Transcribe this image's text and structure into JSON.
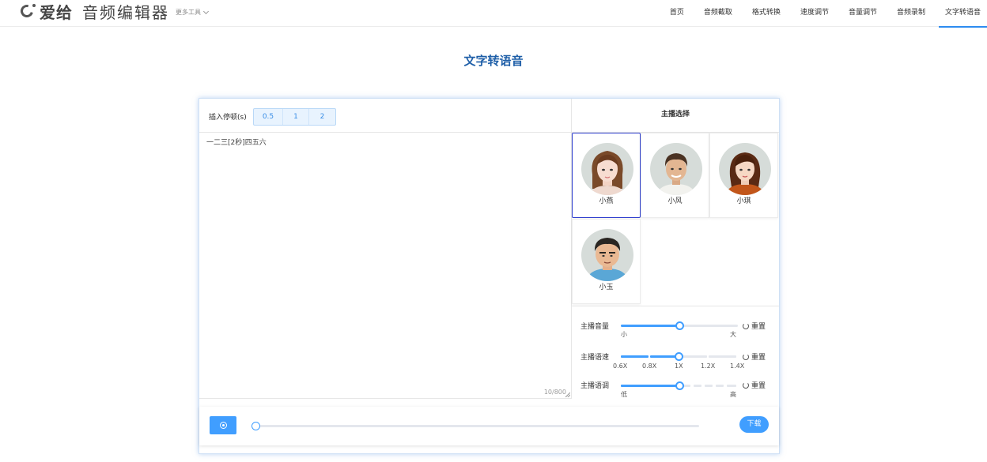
{
  "header": {
    "brand": "爱给",
    "subtitle": "音频编辑器",
    "more_tools": "更多工具",
    "nav": [
      "首页",
      "音频截取",
      "格式转换",
      "速度调节",
      "音量调节",
      "音频录制",
      "文字转语音"
    ],
    "active_nav": "文字转语音"
  },
  "page": {
    "title": "文字转语音"
  },
  "editor": {
    "pause_label": "插入停顿(s)",
    "pause_options": [
      "0.5",
      "1",
      "2"
    ],
    "text": "一二三[2秒]四五六",
    "char_count": "10/800"
  },
  "anchors": {
    "heading": "主播选择",
    "voices": [
      {
        "name": "小燕",
        "selected": true
      },
      {
        "name": "小风",
        "selected": false
      },
      {
        "name": "小琪",
        "selected": false
      },
      {
        "name": "小玉",
        "selected": false
      }
    ]
  },
  "controls": {
    "volume": {
      "label": "主播音量",
      "min": "小",
      "max": "大",
      "level": 0.5,
      "reset": "重置"
    },
    "speed": {
      "label": "主播语速",
      "ticks": [
        "0.6X",
        "0.8X",
        "1X",
        "1.2X",
        "1.4X"
      ],
      "value": "1X",
      "reset": "重置"
    },
    "pitch": {
      "label": "主播语调",
      "min": "低",
      "max": "高",
      "level": 0.5,
      "reset": "重置"
    }
  },
  "player": {
    "progress": 0,
    "download_label": "下载"
  },
  "colors": {
    "accent": "#409eff",
    "title": "#1f5fa8",
    "selected_border": "#2f3fcf"
  }
}
